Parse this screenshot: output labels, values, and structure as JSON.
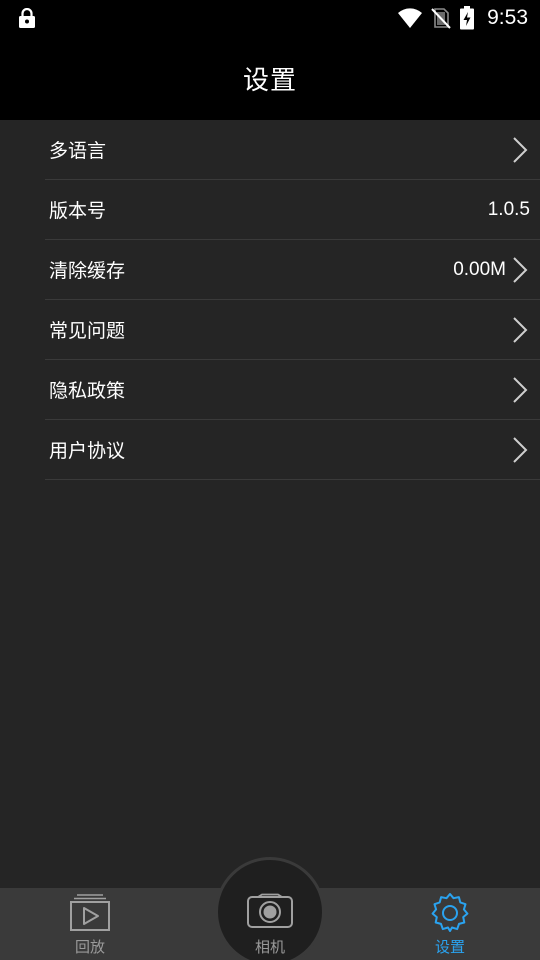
{
  "status_bar": {
    "time": "9:53",
    "icons": [
      "lock-icon",
      "wifi-icon",
      "no-sim-icon",
      "battery-charging-icon"
    ]
  },
  "header": {
    "title": "设置"
  },
  "settings": {
    "items": [
      {
        "label": "多语言",
        "value": "",
        "chevron": true
      },
      {
        "label": "版本号",
        "value": "1.0.5",
        "chevron": false
      },
      {
        "label": "清除缓存",
        "value": "0.00M",
        "chevron": true
      },
      {
        "label": "常见问题",
        "value": "",
        "chevron": true
      },
      {
        "label": "隐私政策",
        "value": "",
        "chevron": true
      },
      {
        "label": "用户协议",
        "value": "",
        "chevron": true
      }
    ]
  },
  "bottom_nav": {
    "items": [
      {
        "label": "回放",
        "icon": "playback-icon",
        "active": false
      },
      {
        "label": "相机",
        "icon": "camera-icon",
        "active": false
      },
      {
        "label": "设置",
        "icon": "gear-icon",
        "active": true
      }
    ]
  },
  "colors": {
    "background": "#252525",
    "header_background": "#000000",
    "nav_background": "#3a3a3a",
    "active_accent": "#2aa3f0",
    "inactive_nav": "#9a9a9a"
  }
}
